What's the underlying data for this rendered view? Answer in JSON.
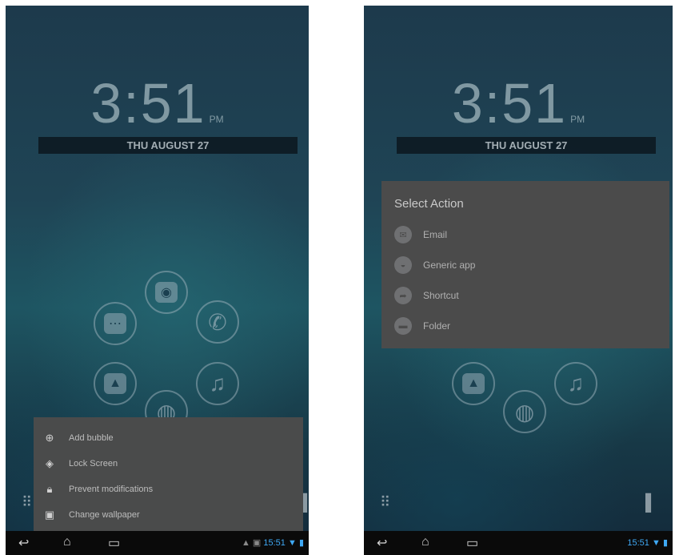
{
  "left_screen": {
    "clock_time": "3:51",
    "clock_ampm": "PM",
    "date": "THU AUGUST 27",
    "menu": [
      {
        "icon": "add-circle-icon",
        "label": "Add bubble"
      },
      {
        "icon": "layers-icon",
        "label": "Lock Screen"
      },
      {
        "icon": "lock-icon",
        "label": "Prevent modifications"
      },
      {
        "icon": "image-icon",
        "label": "Change wallpaper"
      }
    ],
    "status_time": "15:51"
  },
  "right_screen": {
    "clock_time": "3:51",
    "clock_ampm": "PM",
    "date": "THU AUGUST 27",
    "dialog_title": "Select Action",
    "options": [
      {
        "icon": "email-icon",
        "label": "Email"
      },
      {
        "icon": "android-icon",
        "label": "Generic app"
      },
      {
        "icon": "share-arrow-icon",
        "label": "Shortcut"
      },
      {
        "icon": "folder-icon",
        "label": "Folder"
      }
    ],
    "status_time": "15:51"
  },
  "accent_color": "#3fa9f5"
}
